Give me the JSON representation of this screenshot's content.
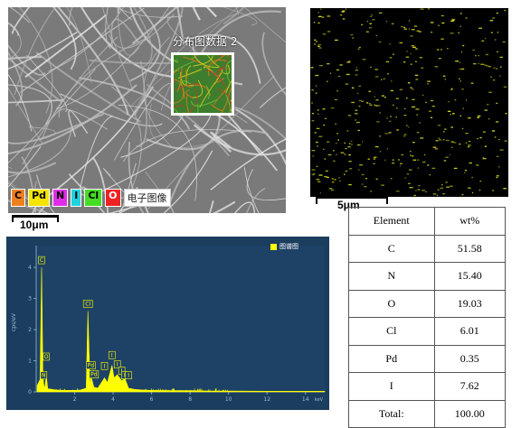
{
  "sem_panel": {
    "map_label": "分布图数据 2",
    "scale_text": "10μm",
    "legend": [
      {
        "text": "C",
        "color": "#f07f1f"
      },
      {
        "text": "Pd",
        "color": "#f4e400"
      },
      {
        "text": "N",
        "color": "#e02ce8"
      },
      {
        "text": "I",
        "color": "#1fd3e0"
      },
      {
        "text": "Cl",
        "color": "#44dd22"
      },
      {
        "text": "O",
        "color": "#ee2222"
      }
    ],
    "legend_label": "电子图像"
  },
  "dot_map": {
    "scale_text": "5μm",
    "dot_color": "#d8d820"
  },
  "spectrum": {
    "legend_label": "图谱图",
    "y_axis_label": "cps/eV",
    "x_unit": "keV",
    "y_ticks": [
      "0",
      "1",
      "2",
      "3",
      "4"
    ],
    "x_ticks": [
      "2",
      "4",
      "6",
      "8",
      "10",
      "12",
      "14"
    ],
    "peak_labels": [
      "C",
      "O",
      "N",
      "Cl",
      "Pd",
      "Pd",
      "I",
      "I",
      "I",
      "I",
      "I",
      "I"
    ]
  },
  "chart_data": {
    "type": "line",
    "title": "",
    "xlabel": "keV",
    "ylabel": "cps/eV",
    "xlim": [
      0,
      15
    ],
    "ylim": [
      0,
      4.7
    ],
    "series": [
      {
        "name": "图谱图",
        "x": [
          0.05,
          0.2,
          0.28,
          0.35,
          0.39,
          0.45,
          0.52,
          0.6,
          0.8,
          1.0,
          1.5,
          2.0,
          2.3,
          2.6,
          2.69,
          2.8,
          2.85,
          3.0,
          3.2,
          3.45,
          3.55,
          3.7,
          3.94,
          4.05,
          4.22,
          4.45,
          4.6,
          4.8,
          5.1,
          5.5,
          6,
          7,
          8,
          9,
          10,
          12,
          14,
          15
        ],
        "y": [
          0.2,
          0.4,
          4.0,
          0.6,
          0.25,
          0.1,
          0.55,
          0.1,
          0.08,
          0.06,
          0.05,
          0.05,
          0.06,
          0.12,
          2.6,
          0.2,
          0.5,
          0.15,
          0.12,
          0.35,
          0.45,
          0.3,
          0.85,
          0.45,
          0.55,
          0.35,
          0.45,
          0.12,
          0.08,
          0.06,
          0.05,
          0.04,
          0.04,
          0.03,
          0.03,
          0.02,
          0.02,
          0.02
        ]
      }
    ],
    "peaks": [
      {
        "label": "C",
        "x": 0.28,
        "y": 4.0
      },
      {
        "label": "N",
        "x": 0.39,
        "y": 0.3
      },
      {
        "label": "O",
        "x": 0.52,
        "y": 0.9
      },
      {
        "label": "Cl",
        "x": 2.69,
        "y": 2.6
      },
      {
        "label": "Pd",
        "x": 2.84,
        "y": 0.62
      },
      {
        "label": "Pd",
        "x": 3.0,
        "y": 0.33
      },
      {
        "label": "I",
        "x": 3.55,
        "y": 0.6
      },
      {
        "label": "I",
        "x": 3.94,
        "y": 0.95
      },
      {
        "label": "I",
        "x": 4.22,
        "y": 0.65
      },
      {
        "label": "I",
        "x": 4.45,
        "y": 0.45
      },
      {
        "label": "I",
        "x": 4.6,
        "y": 0.3
      },
      {
        "label": "I",
        "x": 4.8,
        "y": 0.3
      }
    ]
  },
  "table": {
    "headers": [
      "Element",
      "wt%"
    ],
    "rows": [
      [
        "C",
        "51.58"
      ],
      [
        "N",
        "15.40"
      ],
      [
        "O",
        "19.03"
      ],
      [
        "Cl",
        "6.01"
      ],
      [
        "Pd",
        "0.35"
      ],
      [
        "I",
        "7.62"
      ],
      [
        "Total:",
        "100.00"
      ]
    ]
  }
}
